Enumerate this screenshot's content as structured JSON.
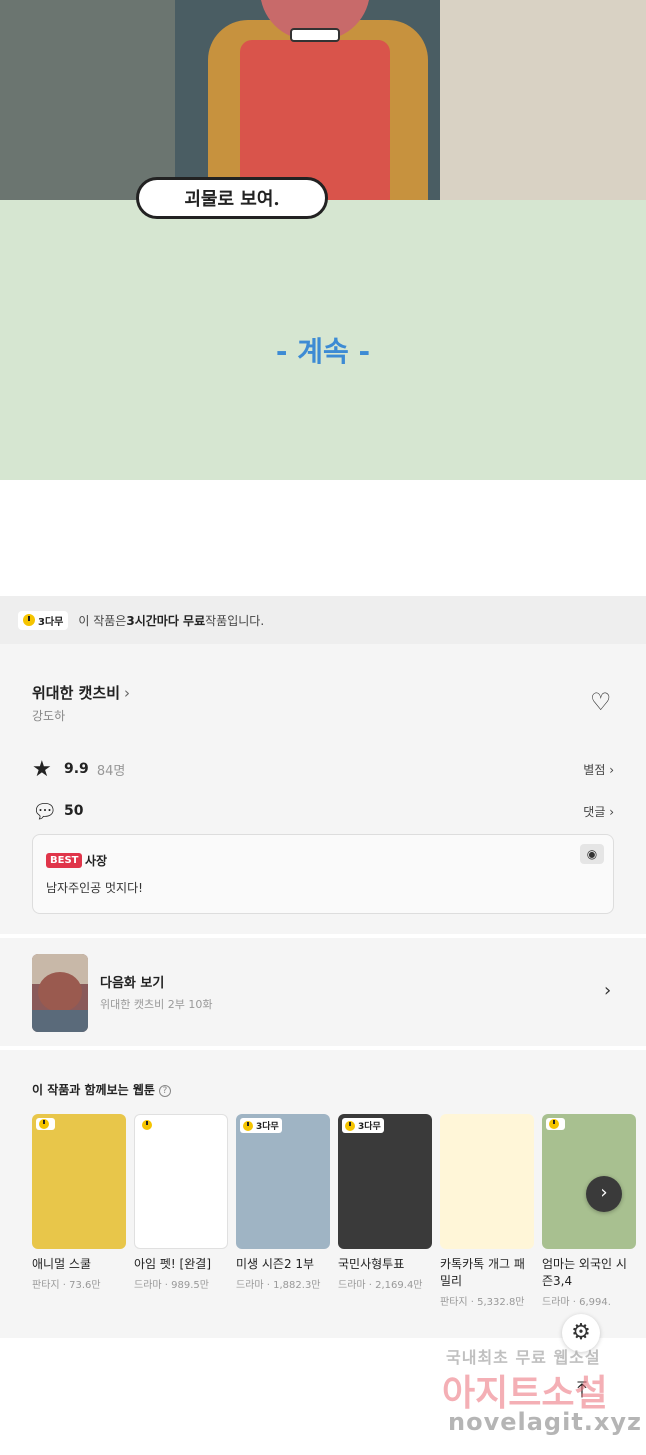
{
  "comic": {
    "speech_text": "괴물로 보여.",
    "continue_text": "- 계속 -"
  },
  "notice": {
    "badge": "3다무",
    "text_prefix": "이 작품은 ",
    "text_bold": "3시간마다 무료",
    "text_suffix": " 작품입니다."
  },
  "work": {
    "title": "위대한 캣츠비",
    "author": "강도하",
    "rating": "9.9",
    "rating_count": "84명",
    "rate_link": "별점",
    "comment_count": "50",
    "comment_link": "댓글"
  },
  "best_comment": {
    "badge": "BEST",
    "user": "사장",
    "text": "남자주인공 멋지다!"
  },
  "next_episode": {
    "label": "다음화 보기",
    "subtitle": "위대한 캣츠비 2부 10화"
  },
  "recommendations": {
    "title": "이 작품과 함께보는 웹툰",
    "items": [
      {
        "name": "애니멀 스쿨",
        "meta": "판타지 · 73.6만",
        "badge": "",
        "color": "#e8c64a"
      },
      {
        "name": "아임 펫! [완결]",
        "meta": "드라마 · 989.5만",
        "badge": "",
        "color": "#ffffff"
      },
      {
        "name": "미생 시즌2 1부",
        "meta": "드라마 · 1,882.3만",
        "badge": "3다무",
        "color": "#9fb4c4"
      },
      {
        "name": "국민사형투표",
        "meta": "드라마 · 2,169.4만",
        "badge": "3다무",
        "color": "#3a3a3a"
      },
      {
        "name": "카톡카톡 개그 패밀리",
        "meta": "판타지 · 5,332.8만",
        "badge": "",
        "color": "#fff6d8"
      },
      {
        "name": "엄마는 외국인 시즌3,4",
        "meta": "드라마 · 6,994.",
        "badge": "",
        "color": "#a8c090"
      }
    ]
  },
  "watermark": {
    "line1": "국내최초 무료 웹소설",
    "line2": "아지트소설",
    "line3": "novelagit.xyz"
  },
  "icons": {
    "heart": "heart-icon",
    "star": "star-icon",
    "comment": "speech-bubble-icon",
    "eye": "eye-icon",
    "gear": "gear-icon",
    "to_top": "arrow-up-icon"
  }
}
